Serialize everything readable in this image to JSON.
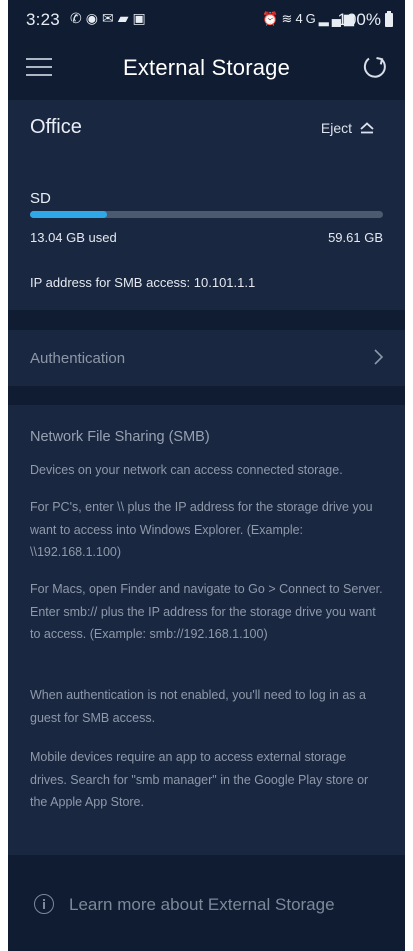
{
  "status_bar": {
    "time": "3:23",
    "left_icons": [
      "whatsapp-icon",
      "hotspot-icon",
      "mail-icon",
      "chat-icon",
      "sim-icon"
    ],
    "right_icons": [
      "alarm-icon",
      "wifi-icon",
      "4g-icon",
      "signal-icon"
    ],
    "battery": "100%"
  },
  "header": {
    "title": "External Storage",
    "menu_icon": "hamburger-icon",
    "refresh_icon": "refresh-icon"
  },
  "storage": {
    "location": "Office",
    "eject_label": "Eject",
    "drive_label": "SD",
    "used": "13.04 GB used",
    "total": "59.61 GB",
    "usage_fraction": 0.219,
    "ip_text": "IP address for SMB access: 10.101.1.1"
  },
  "authentication": {
    "label": "Authentication"
  },
  "info": {
    "title": "Network File Sharing (SMB)",
    "paragraphs": [
      "Devices on your network can access connected storage.",
      "For PC's, enter \\\\ plus the IP address for the storage drive you want to access into Windows Explorer. (Example: \\\\192.168.1.100)",
      "For Macs, open Finder and navigate to Go > Connect to Server. Enter smb:// plus the IP address for the storage drive you want to access. (Example: smb://192.168.1.100)",
      "When authentication is not enabled, you'll need to log in as a guest for SMB access.",
      "Mobile devices require an app to access external storage drives. Search for \"smb manager\" in the Google Play store or the Apple App Store."
    ]
  },
  "footer": {
    "learn_more": "Learn more about External Storage"
  },
  "colors": {
    "background": "#0f1c31",
    "card": "#1a2740",
    "accent": "#2fa8e8"
  }
}
